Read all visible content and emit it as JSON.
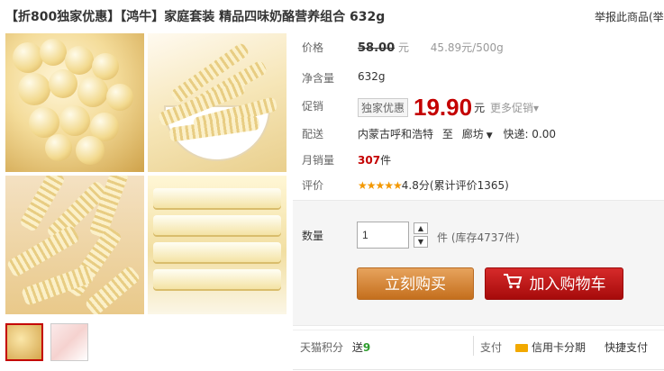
{
  "product": {
    "title": "【折800独家优惠】【鸿牛】家庭套装 精品四味奶酪营养组合 632g",
    "report_link": "举报此商品(举"
  },
  "gallery": {
    "thumbnail_count": 2,
    "active_thumbnail": 1
  },
  "info": {
    "price_label": "价格",
    "original_price": "58.00",
    "original_price_unit": "元",
    "unit_price": "45.89元/500g",
    "weight_label": "净含量",
    "weight": "632g",
    "promo_label": "促销",
    "promo_tag": "独家优惠",
    "promo_price": "19.90",
    "promo_price_unit": "元",
    "more_promos": "更多促销",
    "shipping_label": "配送",
    "ship_from": "内蒙古呼和浩特",
    "ship_to_word": "至",
    "ship_to": "廊坊",
    "express": "快递: 0.00",
    "monthly_sales_label": "月销量",
    "monthly_sales": "307",
    "monthly_sales_unit": "件",
    "rating_label": "评价",
    "rating_stars": "★★★★★",
    "rating_text": "4.8分(累计评价1365)"
  },
  "purchase": {
    "quantity_label": "数量",
    "quantity_value": "1",
    "stock_text": "件 (库存4737件)",
    "buy_now": "立刻购买",
    "add_to_cart": "加入购物车"
  },
  "footer": {
    "points_label": "天猫积分",
    "points_text": "送",
    "points_value": "9",
    "payment_label": "支付",
    "credit_card": "信用卡分期",
    "quick_pay": "快捷支付"
  },
  "colors": {
    "price_red": "#c40000",
    "buy_orange": "#d8873a",
    "cart_red": "#c21616",
    "star_orange": "#f39800"
  }
}
